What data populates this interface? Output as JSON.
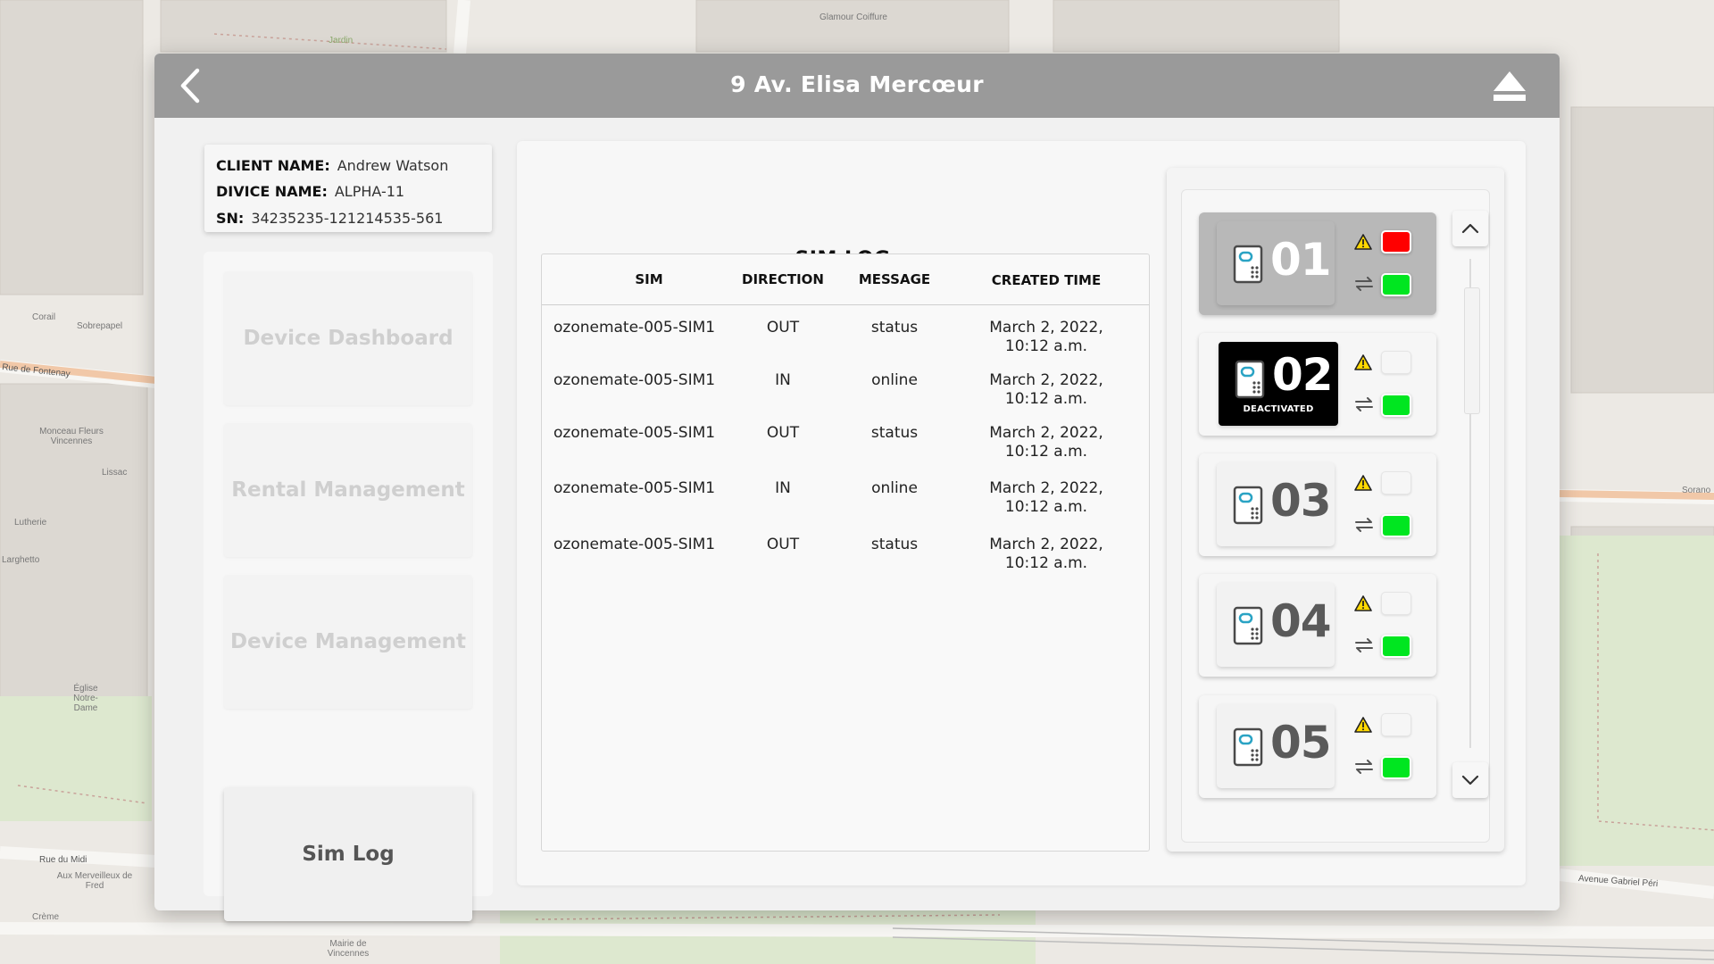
{
  "header": {
    "title": "9 Av. Elisa Mercœur",
    "back_icon": "chevron-left-icon",
    "eject_icon": "eject-icon"
  },
  "client_info": {
    "client_name_label": "CLIENT NAME:",
    "client_name": "Andrew Watson",
    "device_name_label": "DIVICE NAME:",
    "device_name": "ALPHA-11",
    "sn_label": "SN:",
    "sn": "34235235-121214535-561"
  },
  "nav": {
    "items": [
      {
        "label": "Device Dashboard",
        "active": false
      },
      {
        "label": "Rental Management",
        "active": false
      },
      {
        "label": "Device Management",
        "active": false
      },
      {
        "label": "Sim Log",
        "active": true
      }
    ]
  },
  "sim_log": {
    "title": "SIM LOG",
    "columns": [
      "SIM",
      "DIRECTION",
      "MESSAGE",
      "CREATED TIME"
    ],
    "rows": [
      {
        "sim": "ozonemate-005-SIM1",
        "direction": "OUT",
        "message": "status",
        "created_date": "March 2, 2022,",
        "created_time": "10:12 a.m."
      },
      {
        "sim": "ozonemate-005-SIM1",
        "direction": "IN",
        "message": "online",
        "created_date": "March 2, 2022,",
        "created_time": "10:12 a.m."
      },
      {
        "sim": "ozonemate-005-SIM1",
        "direction": "OUT",
        "message": "status",
        "created_date": "March 2, 2022,",
        "created_time": "10:12 a.m."
      },
      {
        "sim": "ozonemate-005-SIM1",
        "direction": "IN",
        "message": "online",
        "created_date": "March 2, 2022,",
        "created_time": "10:12 a.m."
      },
      {
        "sim": "ozonemate-005-SIM1",
        "direction": "OUT",
        "message": "status",
        "created_date": "March 2, 2022,",
        "created_time": "10:12 a.m."
      }
    ]
  },
  "devices": [
    {
      "number": "01",
      "selected": true,
      "deactivated": false,
      "warning_color": "#ff0000",
      "connection_color": "#00e620"
    },
    {
      "number": "02",
      "selected": false,
      "deactivated": true,
      "deactivated_label": "DEACTIVATED",
      "warning_color": "",
      "connection_color": "#00e620"
    },
    {
      "number": "03",
      "selected": false,
      "deactivated": false,
      "warning_color": "",
      "connection_color": "#00e620"
    },
    {
      "number": "04",
      "selected": false,
      "deactivated": false,
      "warning_color": "",
      "connection_color": "#00e620"
    },
    {
      "number": "05",
      "selected": false,
      "deactivated": false,
      "warning_color": "",
      "connection_color": "#00e620"
    }
  ],
  "map_labels": [
    "Jardin",
    "Glamour Coiffure",
    "Corail",
    "Sobrepapel",
    "Rue de Fontenay",
    "Monceau Fleurs Vincennes",
    "Lissac",
    "Lutherie",
    "Larghetto",
    "Église Notre-Dame",
    "Rue du Midi",
    "Aux Merveilleux de Fred",
    "Crème",
    "Mairie de Vincennes",
    "Avenue Gabriel Péri",
    "Sorano"
  ],
  "colors": {
    "header_bg": "#9a9a9a",
    "status_red": "#ff0000",
    "status_green": "#00e620",
    "warning_yellow": "#ffd800"
  }
}
